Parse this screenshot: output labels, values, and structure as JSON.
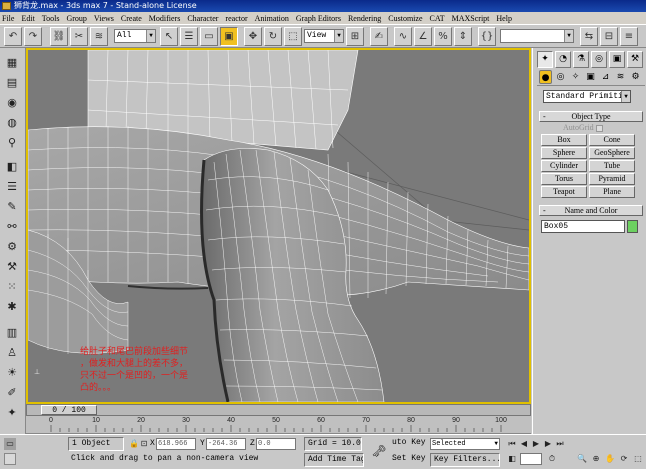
{
  "window": {
    "title": "狮背龙.max - 3ds max 7 - Stand-alone License"
  },
  "menu": [
    "File",
    "Edit",
    "Tools",
    "Group",
    "Views",
    "Create",
    "Modifiers",
    "Character",
    "reactor",
    "Animation",
    "Graph Editors",
    "Rendering",
    "Customize",
    "CAT",
    "MAXScript",
    "Help"
  ],
  "toolbar": {
    "selection_filter": "All",
    "reference_coord": "View"
  },
  "viewport": {
    "annotation_line1": "给肚子和尾巴前段加些细节",
    "annotation_line2": "，做发和大腿上的差不多，",
    "annotation_line3": "只不过一个是凹的，一个是",
    "annotation_line4": "凸的。。。",
    "annotation_color": "#e02020",
    "frame_border_color": "#e0c000"
  },
  "timeline": {
    "frame_counter": "0 / 100",
    "ticks": [
      "0",
      "10",
      "20",
      "30",
      "40",
      "50",
      "60",
      "70",
      "80",
      "90",
      "100"
    ]
  },
  "command_panel": {
    "primitive_type": "Standard Primitives",
    "object_type_title": "Object Type",
    "autogrid_label": "AutoGrid",
    "object_buttons": [
      "Box",
      "Cone",
      "Sphere",
      "GeoSphere",
      "Cylinder",
      "Tube",
      "Torus",
      "Pyramid",
      "Teapot",
      "Plane"
    ],
    "name_color_title": "Name and Color",
    "object_name": "Box05",
    "object_color": "#6cd060"
  },
  "status": {
    "selection_count": "1 Object",
    "x_label": "X",
    "x_value": "618.966",
    "y_label": "Y",
    "y_value": "-264.36",
    "z_label": "Z",
    "z_value": "0.0",
    "grid": "Grid = 10.0",
    "prompt": "Click and drag to pan a non-camera view",
    "add_time_tag": "Add Time Tag",
    "auto_key": "uto Key",
    "set_key": "Set Key",
    "key_mode": "Selected",
    "key_filters": "Key Filters..."
  }
}
